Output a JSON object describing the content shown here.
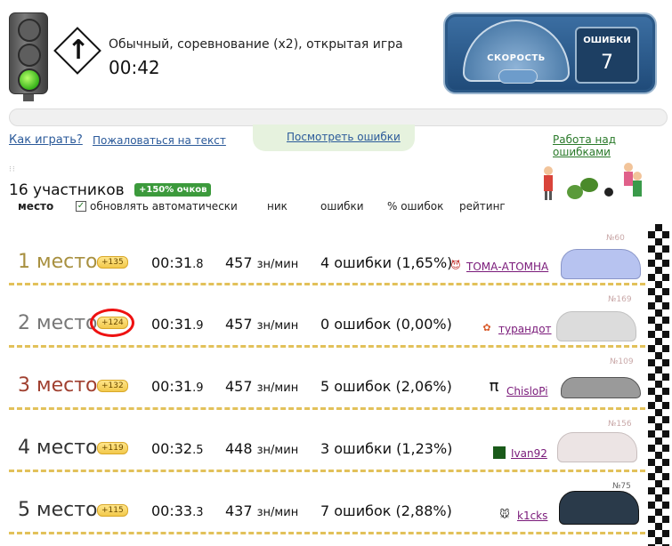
{
  "header": {
    "game_type": "Обычный, соревнование (x2), открытая игра",
    "timer": "00:42",
    "speedometer_label": "СКОРОСТЬ",
    "errors_label": "ОШИБКИ",
    "errors_count": "7"
  },
  "links": {
    "how_to_play": "Как играть?",
    "complain": "Пожаловаться на текст",
    "view_errors": "Посмотреть ошибки",
    "work_on_errors": "Работа над ошибками"
  },
  "summary": {
    "participants": "16 участников",
    "bonus": "+150% очков",
    "auto_update": "обновлять автоматически",
    "auto_update_checked": true
  },
  "columns": {
    "place": "место",
    "nick": "ник",
    "errors": "ошибки",
    "error_pct": "% ошибок",
    "rating": "рейтинг"
  },
  "rows": [
    {
      "place": "1 место",
      "place_color": "#a89040",
      "points": "+135",
      "time_main": "00:31",
      "time_frac": ".8",
      "speed": "457",
      "speed_unit": "зн/мин",
      "errors": "4 ошибки (1,65%)",
      "nick": "ТОМА-АТОМНА",
      "avatar_icon": "devil-icon",
      "car_number": "№60",
      "car_color": "#b7c3f0"
    },
    {
      "place": "2 место",
      "place_color": "#777777",
      "points": "+124",
      "highlighted": true,
      "time_main": "00:31",
      "time_frac": ".9",
      "speed": "457",
      "speed_unit": "зн/мин",
      "errors": "0 ошибок (0,00%)",
      "nick": "турандот",
      "avatar_icon": "flower-icon",
      "car_number": "№169",
      "car_color": "#d8d8d8"
    },
    {
      "place": "3 место",
      "place_color": "#a04030",
      "points": "+132",
      "time_main": "00:31",
      "time_frac": ".9",
      "speed": "457",
      "speed_unit": "зн/мин",
      "errors": "5 ошибок (2,06%)",
      "nick": "ChisloPi",
      "avatar_icon": "pi-icon",
      "car_number": "№109",
      "car_color": "#9a9a9a"
    },
    {
      "place": "4 место",
      "place_color": "#333333",
      "points": "+119",
      "time_main": "00:32",
      "time_frac": ".5",
      "speed": "448",
      "speed_unit": "зн/мин",
      "errors": "3 ошибки (1,23%)",
      "nick": "Ivan92",
      "avatar_icon": "matrix-icon",
      "car_number": "№156",
      "car_color": "#e6dcdc"
    },
    {
      "place": "5 место",
      "place_color": "#333333",
      "points": "+115",
      "time_main": "00:33",
      "time_frac": ".3",
      "speed": "437",
      "speed_unit": "зн/мин",
      "errors": "7 ошибок (2,88%)",
      "nick": "k1cks",
      "avatar_icon": "mouse-icon",
      "car_number": "№75",
      "car_color": "#2a3a4a"
    }
  ]
}
